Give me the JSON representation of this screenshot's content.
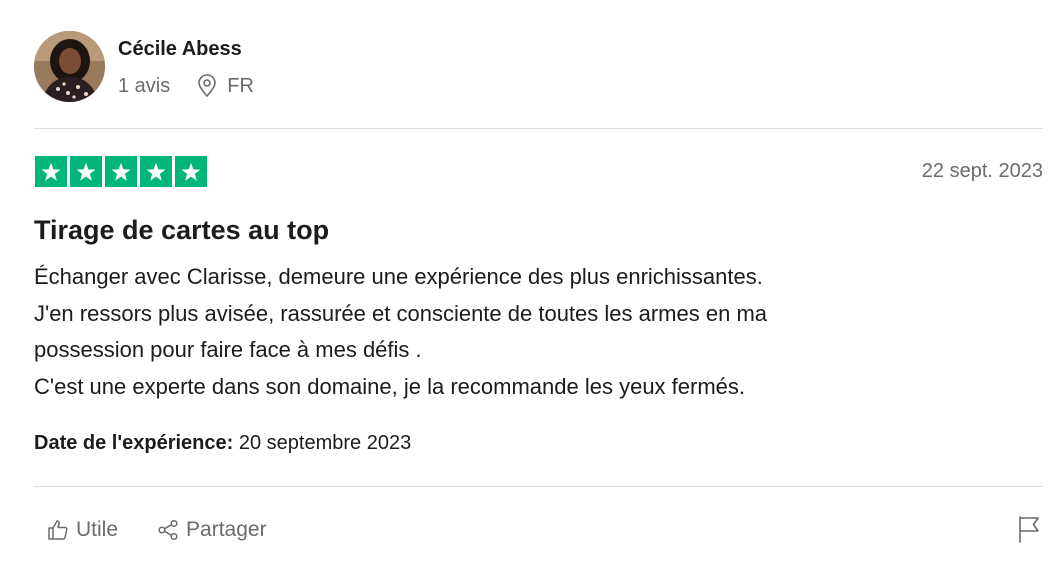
{
  "reviewer": {
    "name": "Cécile Abess",
    "reviews_count": "1 avis",
    "country": "FR",
    "avatar_icon": "reviewer-photo"
  },
  "rating": {
    "stars": 5,
    "max_stars": 5,
    "color": "#00b67a"
  },
  "review": {
    "date": "22 sept. 2023",
    "title": "Tirage de cartes au top",
    "body_lines": [
      "Échanger avec Clarisse, demeure une expérience des plus enrichissantes.",
      "J'en ressors plus avisée, rassurée et consciente de toutes les armes en ma",
      "possession pour faire face à mes défis .",
      "C'est une experte dans son domaine, je la recommande les yeux fermés."
    ],
    "experience_label": "Date de l'expérience:",
    "experience_date": "20 septembre 2023"
  },
  "actions": {
    "useful_label": "Utile",
    "useful_icon": "thumbs-up-icon",
    "share_label": "Partager",
    "share_icon": "share-icon",
    "report_icon": "flag-icon"
  },
  "icons": {
    "location": "location-pin-icon",
    "star": "star-icon"
  }
}
